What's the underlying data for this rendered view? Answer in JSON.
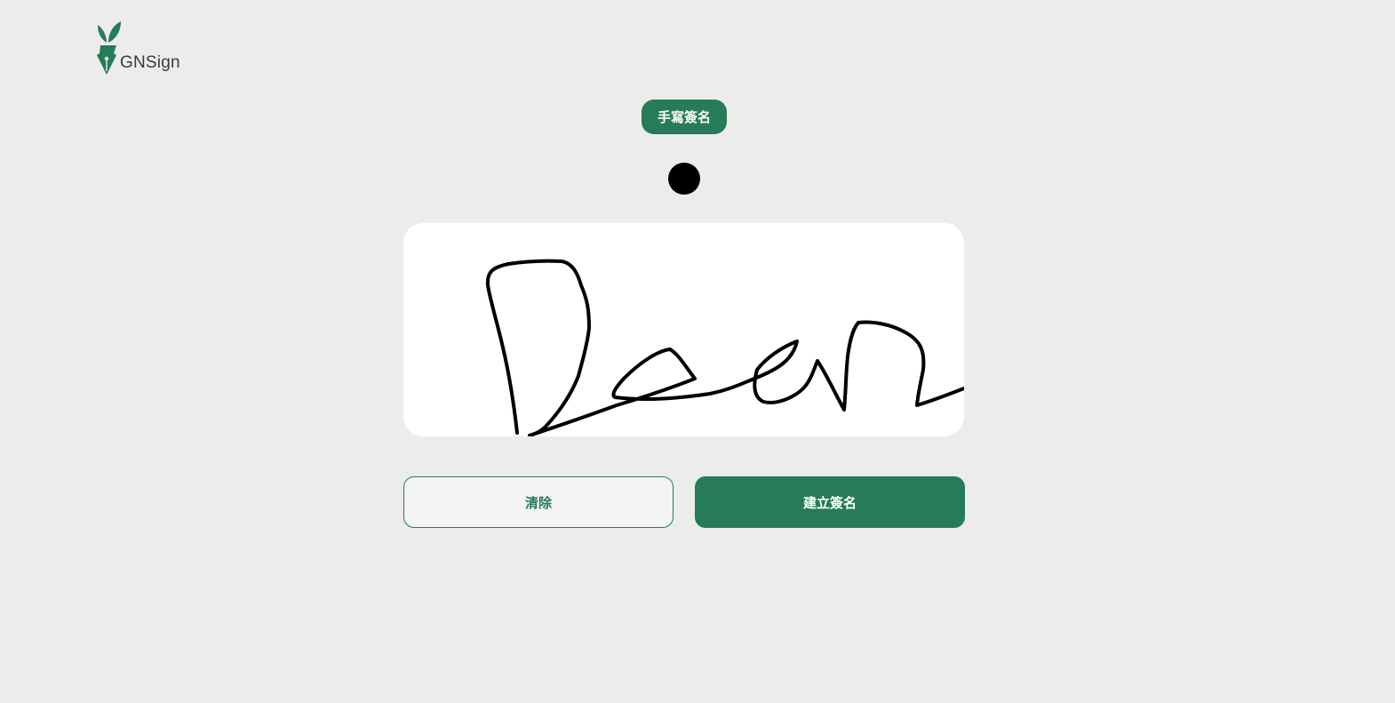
{
  "brand": {
    "name": "GNSign",
    "color": "#267b59",
    "logo_icon": "pen-leaf-icon"
  },
  "signature_mode": {
    "label": "手寫簽名"
  },
  "pen": {
    "color": "#000000",
    "icon": "pen-color-dot"
  },
  "signature_pad": {
    "background": "#ffffff",
    "stroke_color": "#000000"
  },
  "actions": {
    "clear_label": "清除",
    "create_label": "建立簽名"
  },
  "colors": {
    "page_background": "#ececec",
    "accent": "#267b59"
  }
}
